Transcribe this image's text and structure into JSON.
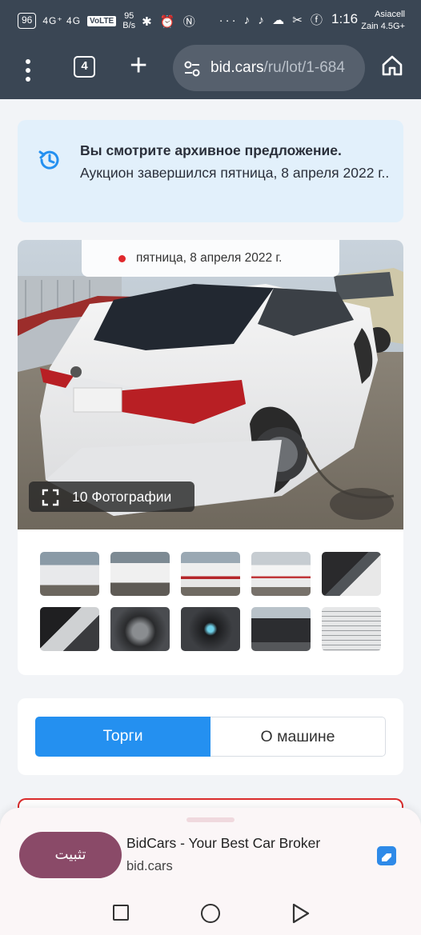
{
  "status_bar": {
    "battery": "96",
    "network": "4G⁺ 4G",
    "volte": "VoLTE",
    "speed_value": "95",
    "speed_unit": "B/s",
    "left_icons": "✱ ⏰ Ⓝ",
    "right_icons": "··· ♪ ♪ ☁ ✂ ⓕ",
    "time": "1:16",
    "carrier_1": "Asiacell",
    "carrier_2": "Zain 4.5G+"
  },
  "browser": {
    "tab_count": "4",
    "url_host": "bid.cars",
    "url_path": "/ru/lot/1-684"
  },
  "notice": {
    "bold": "Вы смотрите архивное предложение.",
    "rest": " Аукцион завершился пятница, 8 апреля 2022 г.."
  },
  "gallery": {
    "auction_date": "пятница, 8 апреля 2022 г.",
    "photos_label": "10 Фотографии",
    "photo_count": 10
  },
  "tabs": {
    "active": "Торги",
    "inactive": "О машине"
  },
  "install_prompt": {
    "button": "تثبيت",
    "title": "BidCars - Your Best Car Broker",
    "host": "bid.cars"
  },
  "icons": [
    "menu-icon",
    "tabs-icon",
    "plus-icon",
    "site-settings-icon",
    "home-icon",
    "history-icon",
    "fullscreen-icon",
    "app-icon",
    "recents-icon",
    "home-nav-icon",
    "back-icon"
  ],
  "colors": {
    "toolbar": "#3a4654",
    "notice_bg": "#e2f0fb",
    "accent": "#2490f0",
    "install": "#8a4a68",
    "alert": "#d92b2b"
  }
}
